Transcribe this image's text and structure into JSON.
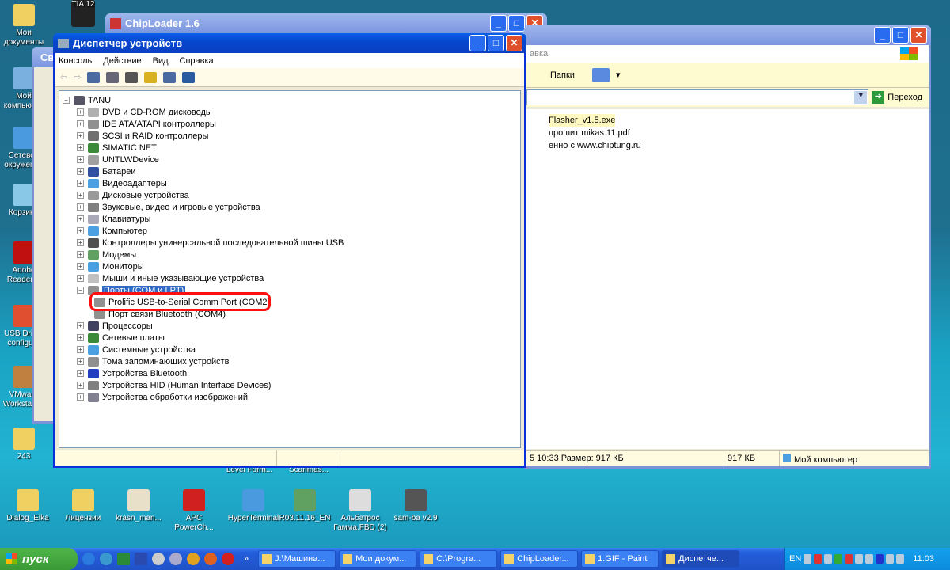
{
  "desktop": {
    "left_icons": [
      "Мои документы",
      "Мой компьютер",
      "Сетевое окружение",
      "Корзина",
      "Adobe Reader X",
      "USB Driver configure",
      "VMware Workstation",
      "243"
    ],
    "bottom_icons": [
      "Dialog_Elka",
      "Лицензии",
      "krasn_man...",
      "APC PowerCh...",
      "HyperTerminal",
      "R03.11.16_EN",
      "Альбатрос Гамма.FBD (2)",
      "sam-ba v2.9"
    ],
    "partial_labels": [
      "Level Form...",
      "Scanmas..."
    ],
    "top_icon_text": "TIA 12"
  },
  "chiploader": {
    "title": "ChipLoader 1.6"
  },
  "props_window": {
    "title": "Сво"
  },
  "explorer": {
    "menu_partial": "авка",
    "folders_label": "Папки",
    "go_label": "Переход",
    "files": [
      "Flasher_v1.5.exe",
      "прошит mikas 11.pdf",
      "енно с www.chiptung.ru"
    ],
    "status": [
      "5 10:33 Размер: 917 КБ",
      "917 КБ",
      "Мой компьютер"
    ]
  },
  "devmgr": {
    "title": "Диспетчер устройств",
    "menu": [
      "Консоль",
      "Действие",
      "Вид",
      "Справка"
    ],
    "root": "TANU",
    "items": [
      {
        "label": "DVD и CD-ROM дисководы",
        "icon": "dvd-icon",
        "color": "#b0b0b0"
      },
      {
        "label": "IDE ATA/ATAPI контроллеры",
        "icon": "ide-icon",
        "color": "#909090"
      },
      {
        "label": "SCSI и RAID контроллеры",
        "icon": "scsi-icon",
        "color": "#707070"
      },
      {
        "label": "SIMATIC NET",
        "icon": "network-card-icon",
        "color": "#3a8a3a"
      },
      {
        "label": "UNTLWDevice",
        "icon": "device-icon",
        "color": "#a0a0a0"
      },
      {
        "label": "Батареи",
        "icon": "battery-icon",
        "color": "#3050a0"
      },
      {
        "label": "Видеоадаптеры",
        "icon": "display-adapter-icon",
        "color": "#4aa0e0"
      },
      {
        "label": "Дисковые устройства",
        "icon": "disk-icon",
        "color": "#9a9a9a"
      },
      {
        "label": "Звуковые, видео и игровые устройства",
        "icon": "sound-icon",
        "color": "#808080"
      },
      {
        "label": "Клавиатуры",
        "icon": "keyboard-icon",
        "color": "#a8a8b8"
      },
      {
        "label": "Компьютер",
        "icon": "computer-icon",
        "color": "#4aa0e0"
      },
      {
        "label": "Контроллеры универсальной последовательной шины USB",
        "icon": "usb-icon",
        "color": "#505050"
      },
      {
        "label": "Модемы",
        "icon": "modem-icon",
        "color": "#60a060"
      },
      {
        "label": "Мониторы",
        "icon": "monitor-icon",
        "color": "#4aa0e0"
      },
      {
        "label": "Мыши и иные указывающие устройства",
        "icon": "mouse-icon",
        "color": "#c0c0c0"
      },
      {
        "label": "Порты (COM и LPT)",
        "icon": "port-icon",
        "color": "#909090",
        "expanded": true,
        "selected": true
      },
      {
        "label": "Prolific USB-to-Serial Comm Port (COM2)",
        "icon": "serial-port-icon",
        "color": "#909090",
        "child": true,
        "highlighted": true
      },
      {
        "label": "Порт связи Bluetooth (COM4)",
        "icon": "serial-port-icon",
        "color": "#909090",
        "child": true
      },
      {
        "label": "Процессоры",
        "icon": "cpu-icon",
        "color": "#404060"
      },
      {
        "label": "Сетевые платы",
        "icon": "network-card-icon",
        "color": "#3a8a3a"
      },
      {
        "label": "Системные устройства",
        "icon": "system-icon",
        "color": "#4aa0e0"
      },
      {
        "label": "Тома запоминающих устройств",
        "icon": "volume-icon",
        "color": "#909090"
      },
      {
        "label": "Устройства Bluetooth",
        "icon": "bluetooth-icon",
        "color": "#2040c0"
      },
      {
        "label": "Устройства HID (Human Interface Devices)",
        "icon": "hid-icon",
        "color": "#808080"
      },
      {
        "label": "Устройства обработки изображений",
        "icon": "imaging-icon",
        "color": "#808090"
      }
    ]
  },
  "taskbar": {
    "start": "пуск",
    "tasks": [
      "J:\\Машина...",
      "Мои докум...",
      "C:\\Progra...",
      "ChipLoader...",
      "1.GIF - Paint",
      "Диспетче..."
    ],
    "lang": "EN",
    "clock": "11:03"
  }
}
